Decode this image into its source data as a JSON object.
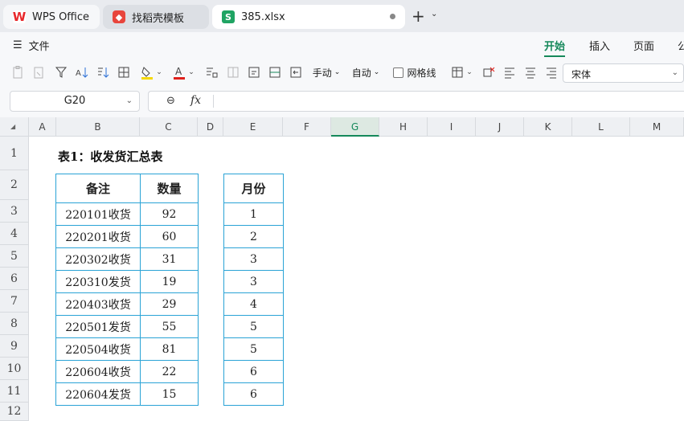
{
  "tabs": [
    {
      "label": "WPS Office"
    },
    {
      "label": "找稻壳模板"
    },
    {
      "label": "385.xlsx"
    }
  ],
  "menu": {
    "file_label": "文件",
    "ribbon_tabs": [
      "开始",
      "插入",
      "页面",
      "公"
    ]
  },
  "toolbar": {
    "wrap_label": "手动",
    "auto_label": "自动",
    "gridlines_label": "网格线",
    "font_name": "宋体",
    "accent_fill": "#f5d800",
    "accent_font": "#e0201b"
  },
  "formula_bar": {
    "name_box": "G20",
    "fx_label": "fx",
    "content": ""
  },
  "columns": [
    "A",
    "B",
    "C",
    "D",
    "E",
    "F",
    "G",
    "H",
    "I",
    "J",
    "K",
    "L",
    "M"
  ],
  "selected_column": "G",
  "rows": [
    "1",
    "2",
    "3",
    "4",
    "5",
    "6",
    "7",
    "8",
    "9",
    "10",
    "11",
    "12"
  ],
  "sheet": {
    "title": "表1：收发货汇总表",
    "table1": {
      "headers": [
        "备注",
        "数量"
      ],
      "rows": [
        [
          "220101收货",
          "92"
        ],
        [
          "220201收货",
          "60"
        ],
        [
          "220302收货",
          "31"
        ],
        [
          "220310发货",
          "19"
        ],
        [
          "220403收货",
          "29"
        ],
        [
          "220501发货",
          "55"
        ],
        [
          "220504收货",
          "81"
        ],
        [
          "220604收货",
          "22"
        ],
        [
          "220604发货",
          "15"
        ]
      ]
    },
    "table2": {
      "header": "月份",
      "rows": [
        "1",
        "2",
        "3",
        "3",
        "4",
        "5",
        "5",
        "6",
        "6"
      ]
    }
  },
  "colors": {
    "accent_green": "#15885a",
    "table_border": "#2aa3d6"
  }
}
